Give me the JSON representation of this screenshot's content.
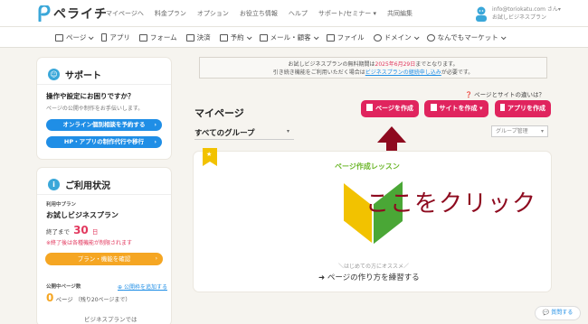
{
  "app": {
    "name": "ペライチ"
  },
  "topnav": [
    "マイページへ",
    "料金プラン",
    "オプション",
    "お役立ち情報",
    "ヘルプ",
    "サポート/セミナー ▾",
    "共同編集"
  ],
  "user": {
    "email": "info@toriokatu.com さん▾",
    "plan": "お試しビジネスプラン"
  },
  "menu": [
    {
      "label": "ページ",
      "dropdown": true
    },
    {
      "label": "アプリ",
      "dropdown": false
    },
    {
      "label": "フォーム",
      "dropdown": false
    },
    {
      "label": "決済",
      "dropdown": false
    },
    {
      "label": "予約",
      "dropdown": true
    },
    {
      "label": "メール・顧客",
      "dropdown": true
    },
    {
      "label": "ファイル",
      "dropdown": false
    },
    {
      "label": "ドメイン",
      "dropdown": true
    },
    {
      "label": "なんでもマーケット",
      "dropdown": true
    }
  ],
  "support": {
    "title": "サポート",
    "question": "操作や設定にお困りですか？",
    "desc": "ページの公開や制作をお手伝いします。",
    "btn_consult": "オンライン個別相談を予約する",
    "btn_agency": "HP・アプリの制作代行や移行"
  },
  "status": {
    "title": "ご利用状況",
    "plan_label": "利用中プラン",
    "plan_name": "お試しビジネスプラン",
    "end_prefix": "終了まで",
    "days_left": "30",
    "days_unit": "日",
    "warning": "※終了後は各種機能が制限されます",
    "plan_button": "プラン・機能を確認",
    "pages_label": "公開中ページ数",
    "add_pages": "公開枠を追加する",
    "pages_count": "0",
    "pages_unit": "ページ",
    "pages_remaining": "（残り20ページまで）",
    "business_note": "ビジネスプランでは"
  },
  "notice": {
    "line1_pre": "お試しビジネスプランの無料期間は",
    "line1_date": "2025年6月29日",
    "line1_post": "までとなります。",
    "line2_pre": "引き続き機能をご利用いただく場合は",
    "line2_link": "ビジネスプランの継続申し込み",
    "line2_post": "が必要です。"
  },
  "main": {
    "page_title": "マイページ",
    "help_link": "ページとサイトの違いは？",
    "group_label": "すべてのグループ",
    "group_manage": "グループ管理",
    "btn_page": "ページを作成",
    "btn_site": "サイトを作成",
    "btn_app": "アプリを作成"
  },
  "lesson": {
    "title": "ページ作成レッスン",
    "annotation": "ここをクリック",
    "subtitle": "＼はじめての方にオススメ／",
    "action": "ページの作り方を練習する"
  },
  "chat": {
    "label": "質問する"
  },
  "colors": {
    "accent_pink": "#e0245e",
    "blue": "#1f8ee6",
    "orange": "#f5a623",
    "annotation": "#8e0a1f",
    "lesson_green": "#6db72c"
  }
}
